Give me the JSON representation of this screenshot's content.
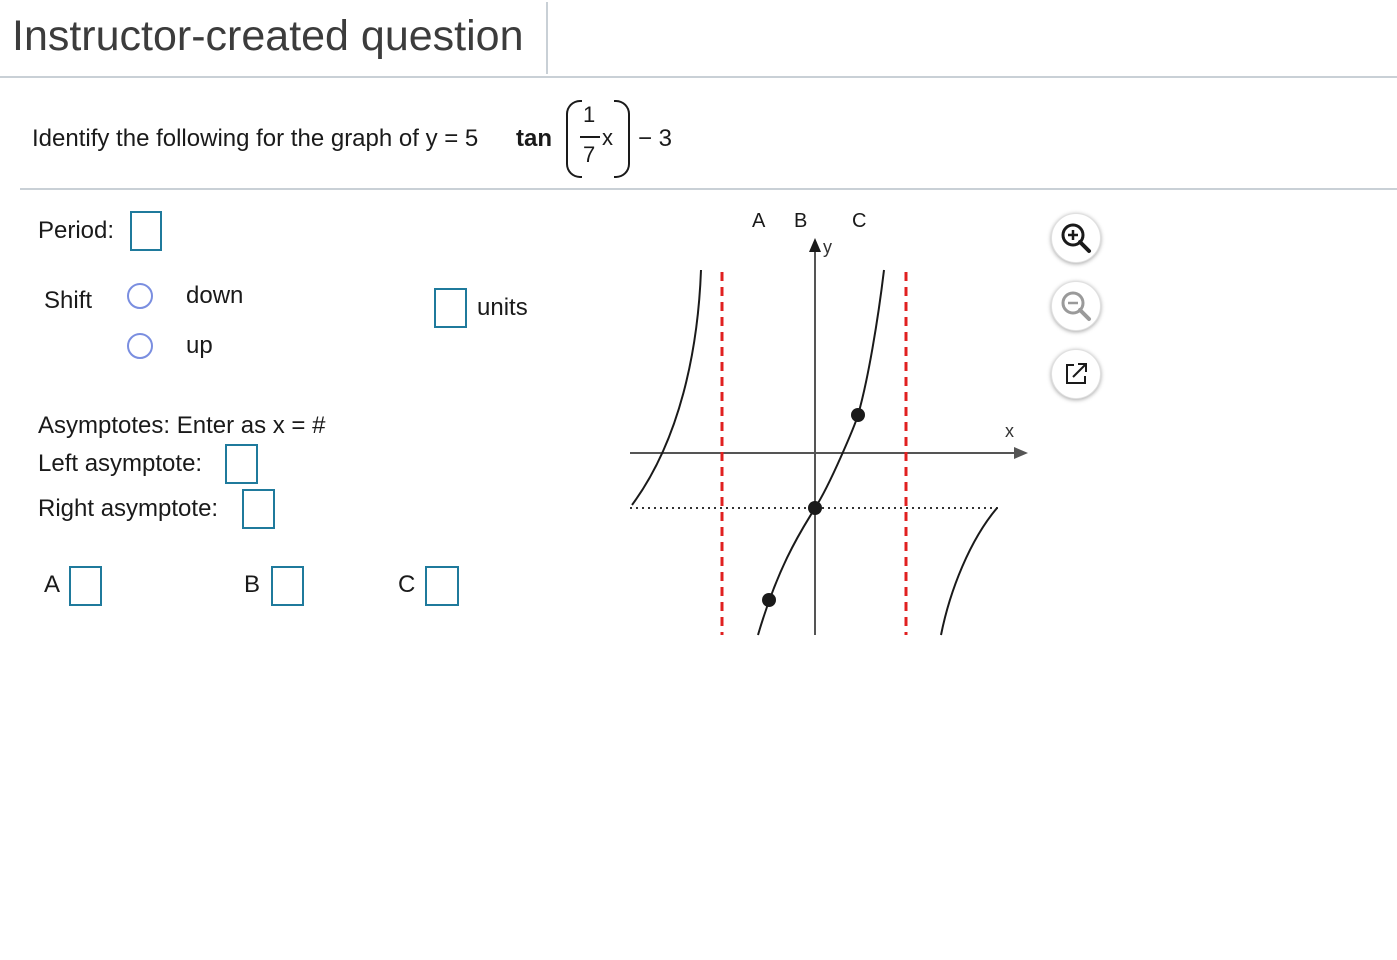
{
  "header": {
    "title": "Instructor-created question"
  },
  "question": {
    "prompt": "Identify the following for the graph of y = 5",
    "function_name": "tan",
    "fraction_numerator": "1",
    "fraction_denominator": "7",
    "variable": "x",
    "tail": "− 3"
  },
  "form": {
    "period_label": "Period:",
    "shift_label": "Shift",
    "shift_options": [
      "down",
      "up"
    ],
    "shift_selected": null,
    "units_label": "units",
    "asymptotes_instruction": "Asymptotes: Enter as x = #",
    "left_asymptote_label": "Left asymptote:",
    "right_asymptote_label": "Right asymptote:",
    "point_labels": [
      "A",
      "B",
      "C"
    ],
    "fields": {
      "period": "",
      "shift_units": "",
      "left_asymptote": "",
      "right_asymptote": "",
      "A": "",
      "B": "",
      "C": ""
    }
  },
  "graph": {
    "top_labels": [
      "A",
      "B",
      "C"
    ],
    "x_axis_label": "x",
    "y_axis_label": "y",
    "asymptote_color": "#e02020"
  },
  "tools": {
    "zoom_in": "zoom-in-icon",
    "zoom_out": "zoom-out-icon",
    "popout": "popout-icon"
  }
}
